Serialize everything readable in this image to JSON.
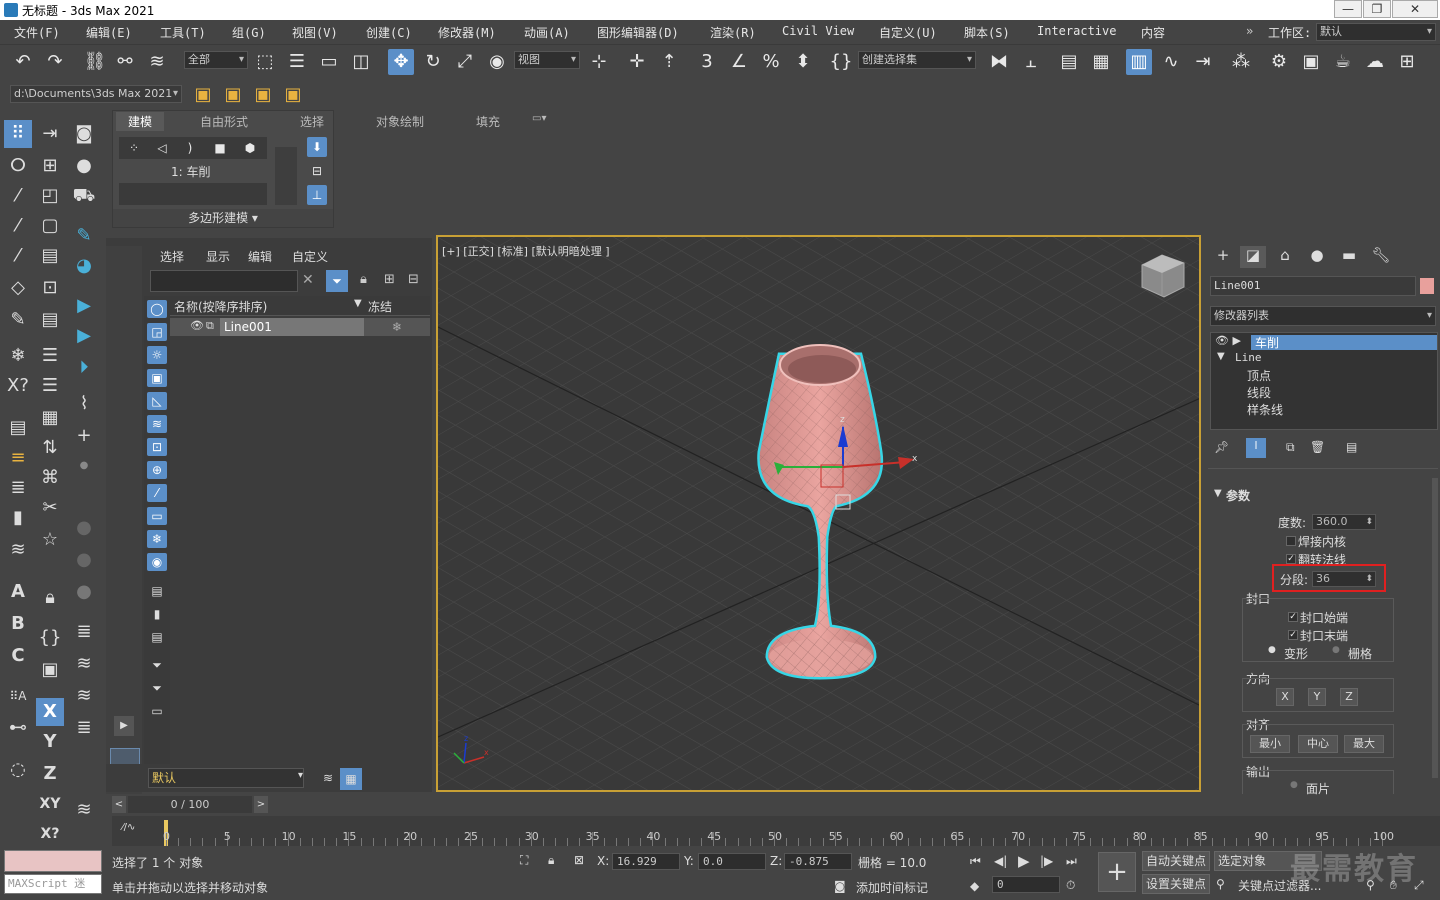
{
  "titlebar": {
    "title": "无标题 - 3ds Max 2021"
  },
  "menubar": {
    "items": [
      "文件(F)",
      "编辑(E)",
      "工具(T)",
      "组(G)",
      "视图(V)",
      "创建(C)",
      "修改器(M)",
      "动画(A)",
      "图形编辑器(D)",
      "渲染(R)",
      "Civil View",
      "自定义(U)",
      "脚本(S)",
      "Interactive",
      "内容"
    ],
    "workspace_label": "工作区:",
    "workspace_value": "默认"
  },
  "toolbar": {
    "filter_value": "全部",
    "refcoord_value": "视图",
    "selection_set_placeholder": "创建选择集"
  },
  "path_bar": {
    "path": "d:\\Documents\\3ds Max 2021"
  },
  "ribbon": {
    "tabs": [
      "建模",
      "自由形式",
      "选择",
      "对象绘制",
      "填充"
    ],
    "modifier_label": "1: 车削",
    "footer": "多边形建模"
  },
  "explorer": {
    "tabs": [
      "选择",
      "显示",
      "编辑",
      "自定义"
    ],
    "col_name": "名称(按降序排序)",
    "col_freeze": "冻结",
    "object": "Line001",
    "layer": "默认"
  },
  "viewport": {
    "label": "[+] [正交] [标准] [默认明暗处理 ]"
  },
  "command_panel": {
    "object_name": "Line001",
    "modifier_list": "修改器列表",
    "stack": [
      "车削",
      "Line",
      "顶点",
      "线段",
      "样条线"
    ],
    "rollout": "参数",
    "degrees_label": "度数:",
    "degrees": "360.0",
    "weld_core": "焊接内核",
    "flip_normals": "翻转法线",
    "segments_label": "分段:",
    "segments": "36",
    "capping": "封口",
    "cap_start": "封口始端",
    "cap_end": "封口末端",
    "morph": "变形",
    "grid": "栅格",
    "direction": "方向",
    "axis_x": "X",
    "axis_y": "Y",
    "axis_z": "Z",
    "align": "对齐",
    "align_min": "最小",
    "align_center": "中心",
    "align_max": "最大",
    "output": "输出",
    "output_item": "面片"
  },
  "timeline": {
    "frame": "0 / 100",
    "ticks": [
      "0",
      "5",
      "10",
      "15",
      "20",
      "25",
      "30",
      "35",
      "40",
      "45",
      "50",
      "55",
      "60",
      "65",
      "70",
      "75",
      "80",
      "85",
      "90",
      "95",
      "100"
    ]
  },
  "status": {
    "maxscript": "MAXScript 迷",
    "selected": "选择了 1 个 对象",
    "hint": "单击并拖动以选择并移动对象",
    "x_label": "X:",
    "x": "16.929",
    "y_label": "Y:",
    "y": "0.0",
    "z_label": "Z:",
    "z": "-0.875",
    "grid": "栅格 = 10.0",
    "add_time_tag": "添加时间标记",
    "auto_key": "自动关键点",
    "selected_obj": "选定对象",
    "set_key": "设置关键点",
    "key_filter": "关键点过滤器...",
    "frame_field": "0",
    "watermark": "最需教育"
  },
  "colors": {
    "accent": "#5b8fc8",
    "viewport_border": "#c8a035",
    "object": "#e8a09c",
    "selection_outline": "#37d6e6",
    "highlight_box": "#e02020"
  }
}
